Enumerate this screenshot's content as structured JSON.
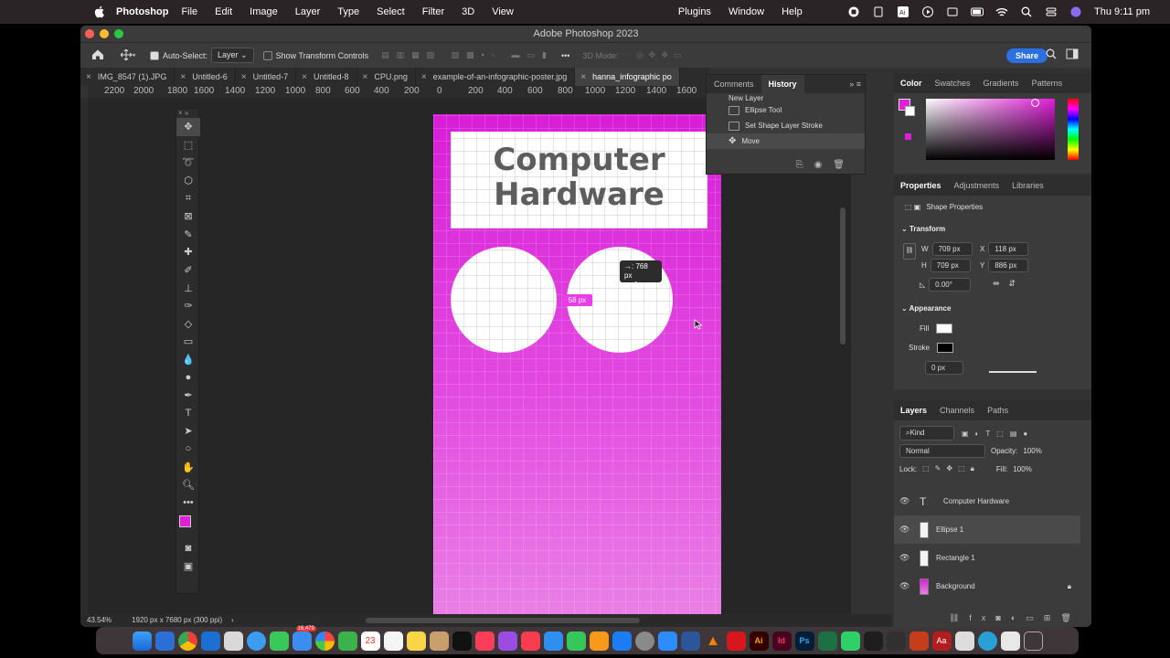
{
  "menubar": {
    "app_name": "Photoshop",
    "items": [
      "File",
      "Edit",
      "Image",
      "Layer",
      "Type",
      "Select",
      "Filter",
      "3D",
      "View"
    ],
    "right_items": [
      "Plugins",
      "Window",
      "Help"
    ],
    "clock": "Thu 9:11 pm"
  },
  "window": {
    "title": "Adobe Photoshop 2023"
  },
  "options": {
    "auto_select_label": "Auto-Select:",
    "auto_select_value": "Layer",
    "transform_controls_label": "Show Transform Controls",
    "mode_3d_label": "3D Mode:",
    "share_label": "Share"
  },
  "tabs": [
    {
      "label": "IMG_8547 (1).JPG"
    },
    {
      "label": "Untitled-6"
    },
    {
      "label": "Untitled-7"
    },
    {
      "label": "Untitled-8"
    },
    {
      "label": "CPU.png"
    },
    {
      "label": "example-of-an-infographic-poster.jpg"
    },
    {
      "label": "hanna_infographic po"
    }
  ],
  "ruler": [
    "2200",
    "2000",
    "1800",
    "1600",
    "1400",
    "1200",
    "1000",
    "800",
    "600",
    "400",
    "200",
    "0",
    "200",
    "400",
    "600",
    "800",
    "1000",
    "1200",
    "1400",
    "1600"
  ],
  "canvas": {
    "title_line1": "Computer",
    "title_line2": "Hardware",
    "measure_line1": "→: 768 px",
    "measure_line2": "↓ :     1 px",
    "badge": "58 px"
  },
  "history": {
    "tabs": [
      "Comments",
      "History"
    ],
    "items": [
      "New Layer",
      "Ellipse Tool",
      "Set Shape Layer Stroke",
      "Move"
    ]
  },
  "color_panel": {
    "tabs": [
      "Color",
      "Swatches",
      "Gradients",
      "Patterns"
    ],
    "fg_color": "#e01fd8",
    "bg_color": "#ffffff"
  },
  "properties": {
    "tabs": [
      "Properties",
      "Adjustments",
      "Libraries"
    ],
    "kind": "Shape Properties",
    "transform_label": "Transform",
    "w_label": "W",
    "w": "709 px",
    "h_label": "H",
    "h": "709 px",
    "x_label": "X",
    "x": "118 px",
    "y_label": "Y",
    "y": "886 px",
    "angle": "0.00°",
    "appearance_label": "Appearance",
    "fill_label": "Fill",
    "stroke_label": "Stroke",
    "stroke_width": "0 px"
  },
  "layers_panel": {
    "tabs": [
      "Layers",
      "Channels",
      "Paths"
    ],
    "kind": "Kind",
    "blend": "Normal",
    "opacity_label": "Opacity:",
    "opacity": "100%",
    "lock_label": "Lock:",
    "fill_label": "Fill:",
    "fill": "100%",
    "layers": [
      {
        "name": "Computer Hardware"
      },
      {
        "name": "Ellipse 1"
      },
      {
        "name": "Rectangle 1"
      },
      {
        "name": "Background"
      }
    ]
  },
  "status": {
    "zoom": "43.54%",
    "doc_info": "1920 px x 7680 px (300 ppi)"
  },
  "dock": {
    "badges": [
      "16,479",
      "23"
    ]
  }
}
